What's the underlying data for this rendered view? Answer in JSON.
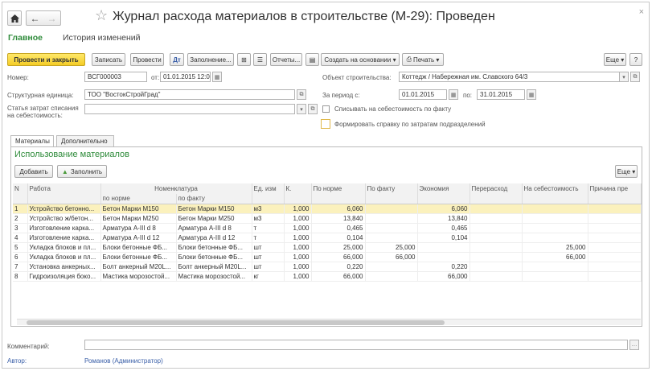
{
  "window": {
    "title": "Журнал расхода материалов в строительстве (М-29): Проведен"
  },
  "nav": {
    "home_icon": "home-icon",
    "back": "←",
    "forward": "→",
    "star": "☆"
  },
  "main_tabs": {
    "main": "Главное",
    "history": "История изменений"
  },
  "toolbar": {
    "post_close": "Провести и закрыть",
    "save": "Записать",
    "post": "Провести",
    "fill": "Заполнение...",
    "reports": "Отчеты...",
    "create_based": "Создать на основании ▾",
    "print": "Печать ▾",
    "more": "Еще ▾",
    "help": "?"
  },
  "form": {
    "number_label": "Номер:",
    "number_value": "ВСГ000003",
    "date_label": "от:",
    "date_value": "01.01.2015 12:0",
    "unit_label": "Структурная единица:",
    "unit_value": "ТОО \"ВостокСтройГрад\"",
    "cost_label_1": "Статья затрат списания",
    "cost_label_2": "на себестоимость:",
    "cost_value": "",
    "object_label": "Объект строительства:",
    "object_value": "Коттедж / Набережная им. Славского 64/3",
    "period_label": "За период с:",
    "period_from": "01.01.2015",
    "period_to_label": "по:",
    "period_to": "31.01.2015",
    "writeoff_actual": "Списывать на себестоимость по факту",
    "dept_report": "Формировать справку по затратам подразделений"
  },
  "doc_tabs": {
    "materials": "Материалы",
    "additional": "Дополнительно"
  },
  "materials": {
    "section_title": "Использование материалов",
    "add": "Добавить",
    "fill": "Заполнить",
    "more": "Еще ▾",
    "headers": {
      "n": "N",
      "work": "Работа",
      "nomenclature": "Номенклатура",
      "by_norm_sub": "по норме",
      "by_fact_sub": "по факту",
      "unit": "Ед. изм",
      "k": "К.",
      "by_norm": "По норме",
      "by_fact": "По факту",
      "economy": "Экономия",
      "overuse": "Перерасход",
      "to_cost": "На себестоимость",
      "reason": "Причина пре"
    },
    "rows": [
      {
        "n": "1",
        "work": "Устройство бетонно...",
        "norm_item": "Бетон Марки М150",
        "fact_item": "Бетон Марки М150",
        "unit": "м3",
        "k": "1,000",
        "by_norm": "6,060",
        "by_fact": "",
        "economy": "6,060",
        "overuse": "",
        "to_cost": "",
        "reason": ""
      },
      {
        "n": "2",
        "work": "Устройство ж/бетон...",
        "norm_item": "Бетон Марки М250",
        "fact_item": "Бетон Марки М250",
        "unit": "м3",
        "k": "1,000",
        "by_norm": "13,840",
        "by_fact": "",
        "economy": "13,840",
        "overuse": "",
        "to_cost": "",
        "reason": ""
      },
      {
        "n": "3",
        "work": "Изготовление карка...",
        "norm_item": "Арматура A-III d 8",
        "fact_item": "Арматура A-III d 8",
        "unit": "т",
        "k": "1,000",
        "by_norm": "0,465",
        "by_fact": "",
        "economy": "0,465",
        "overuse": "",
        "to_cost": "",
        "reason": ""
      },
      {
        "n": "4",
        "work": "Изготовление карка...",
        "norm_item": "Арматура A-III d 12",
        "fact_item": "Арматура A-III d 12",
        "unit": "т",
        "k": "1,000",
        "by_norm": "0,104",
        "by_fact": "",
        "economy": "0,104",
        "overuse": "",
        "to_cost": "",
        "reason": ""
      },
      {
        "n": "5",
        "work": "Укладка блоков и пл...",
        "norm_item": "Блоки бетонные ФБ...",
        "fact_item": "Блоки бетонные ФБ...",
        "unit": "шт",
        "k": "1,000",
        "by_norm": "25,000",
        "by_fact": "25,000",
        "economy": "",
        "overuse": "",
        "to_cost": "25,000",
        "reason": ""
      },
      {
        "n": "6",
        "work": "Укладка блоков и пл...",
        "norm_item": "Блоки бетонные ФБ...",
        "fact_item": "Блоки бетонные ФБ...",
        "unit": "шт",
        "k": "1,000",
        "by_norm": "66,000",
        "by_fact": "66,000",
        "economy": "",
        "overuse": "",
        "to_cost": "66,000",
        "reason": ""
      },
      {
        "n": "7",
        "work": "Установка анкерных...",
        "norm_item": "Болт анкерный М20L...",
        "fact_item": "Болт анкерный М20L...",
        "unit": "шт",
        "k": "1,000",
        "by_norm": "0,220",
        "by_fact": "",
        "economy": "0,220",
        "overuse": "",
        "to_cost": "",
        "reason": ""
      },
      {
        "n": "8",
        "work": "Гидроизоляция боко...",
        "norm_item": "Мастика морозостой...",
        "fact_item": "Мастика морозостой...",
        "unit": "кг",
        "k": "1,000",
        "by_norm": "66,000",
        "by_fact": "",
        "economy": "66,000",
        "overuse": "",
        "to_cost": "",
        "reason": ""
      }
    ]
  },
  "footer": {
    "comment_label": "Комментарий:",
    "comment_value": "",
    "author_label": "Автор:",
    "author_value": "Романов (Администратор)"
  },
  "colors": {
    "accent_green": "#2e8b3a",
    "selected_row": "#fbf1bd",
    "primary_button": "#f4cc26",
    "link_blue": "#3a5fa8"
  }
}
